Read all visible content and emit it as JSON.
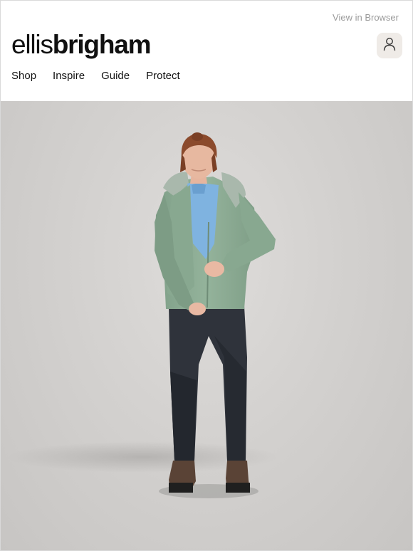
{
  "header": {
    "view_in_browser": "View in Browser",
    "logo": {
      "light": "ellis",
      "bold": "brigham"
    },
    "account_icon": "user-icon"
  },
  "nav": {
    "items": [
      {
        "label": "Shop"
      },
      {
        "label": "Inspire"
      },
      {
        "label": "Guide"
      },
      {
        "label": "Protect"
      }
    ]
  },
  "hero": {
    "image": "woman-in-green-jacket-photo",
    "colors": {
      "background": "#d3d1cf",
      "jacket": "#8fae96",
      "top": "#7fb3e0",
      "trousers": "#2f333b",
      "hair": "#8b4a2c"
    }
  }
}
